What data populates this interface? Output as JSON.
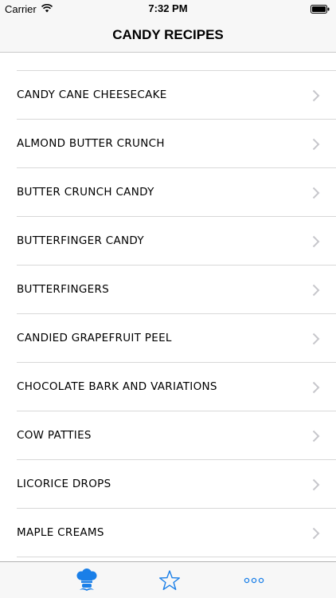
{
  "status_bar": {
    "carrier": "Carrier",
    "time": "7:32 PM"
  },
  "nav": {
    "title": "CANDY RECIPES"
  },
  "recipes": [
    {
      "label": "CANDY CANE CHEESECAKE"
    },
    {
      "label": "ALMOND BUTTER CRUNCH"
    },
    {
      "label": "BUTTER CRUNCH CANDY"
    },
    {
      "label": "BUTTERFINGER CANDY"
    },
    {
      "label": "BUTTERFINGERS"
    },
    {
      "label": "CANDIED GRAPEFRUIT PEEL"
    },
    {
      "label": "CHOCOLATE BARK AND VARIATIONS"
    },
    {
      "label": "COW PATTIES"
    },
    {
      "label": "LICORICE DROPS"
    },
    {
      "label": "MAPLE CREAMS"
    }
  ],
  "tab_bar": {
    "tabs": [
      {
        "icon": "chef-icon",
        "active": true
      },
      {
        "icon": "star-icon",
        "active": false
      },
      {
        "icon": "more-icon",
        "active": false
      }
    ]
  },
  "colors": {
    "accent": "#1a7fe8",
    "chevron": "#c7c7cc",
    "separator": "#d8d8d8"
  }
}
